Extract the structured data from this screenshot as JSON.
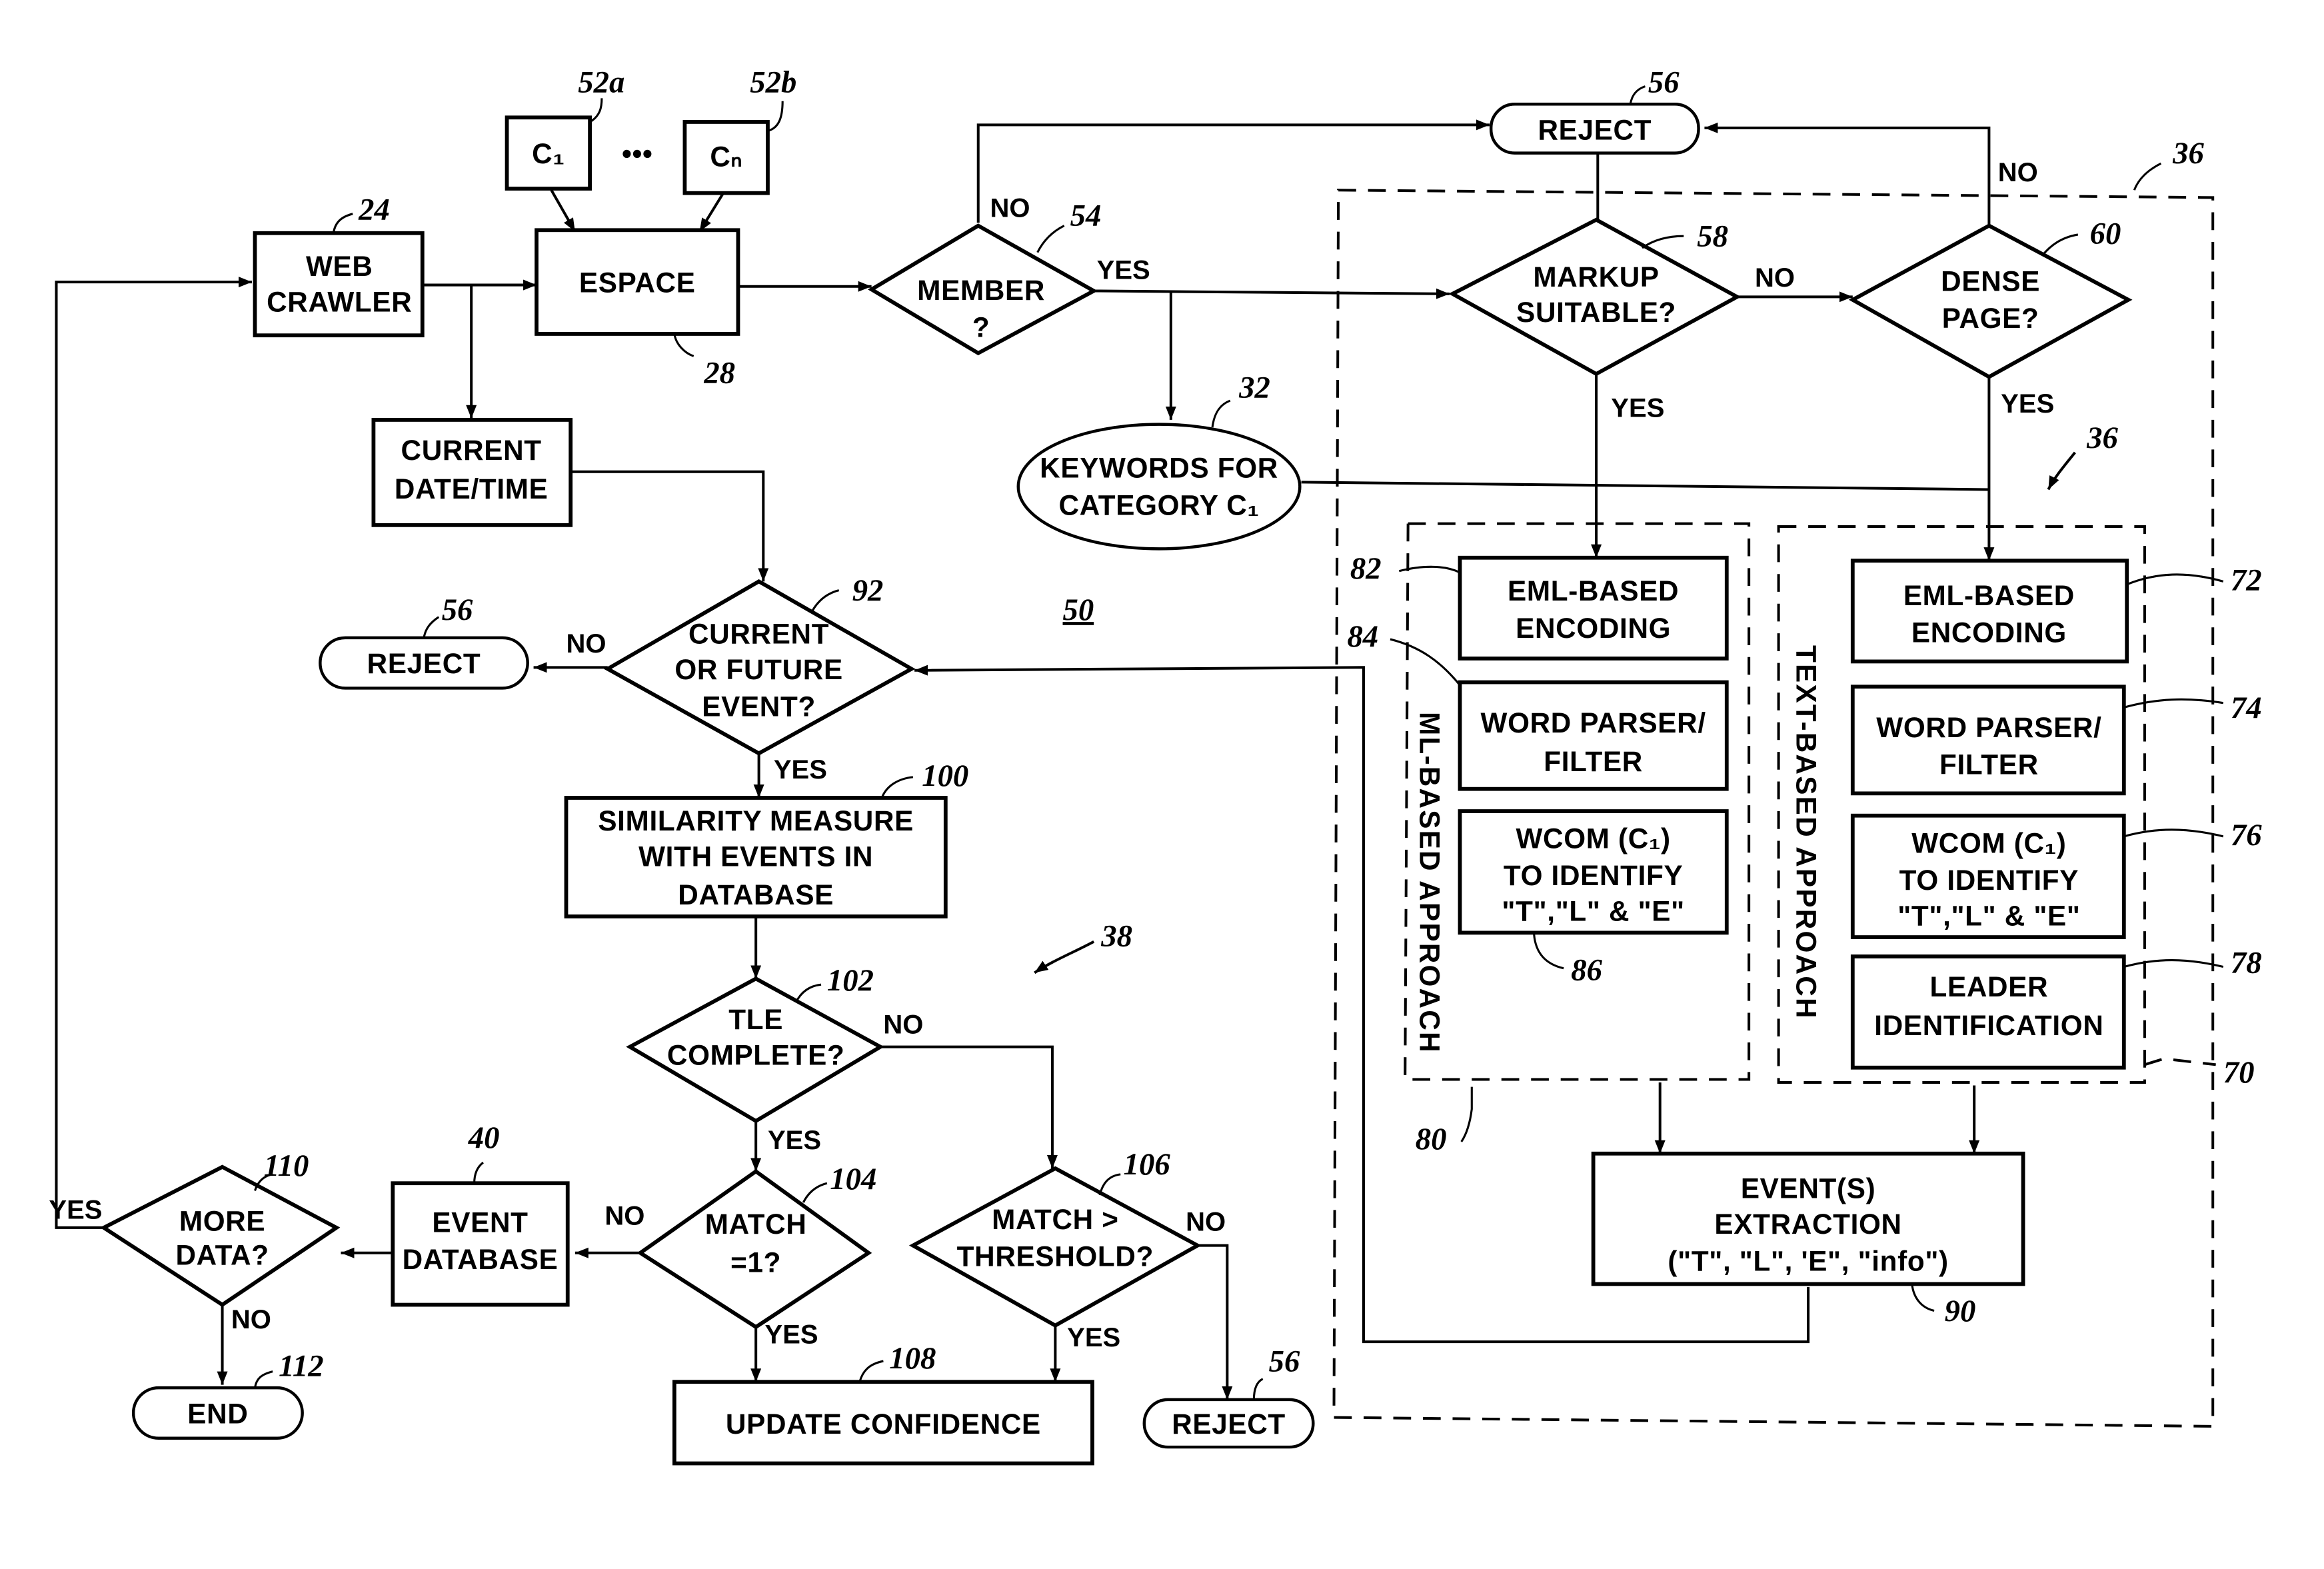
{
  "figure_number": "50",
  "nodes": {
    "web_crawler": {
      "lines": [
        "WEB",
        "CRAWLER"
      ],
      "ref": "24"
    },
    "espace": {
      "lines": [
        "ESPACE"
      ],
      "ref": "28"
    },
    "c1": {
      "lines": [
        "C₁"
      ],
      "ref": "52a"
    },
    "cn": {
      "lines": [
        "Cₙ"
      ],
      "ref": "52b"
    },
    "ellipsis": "•••",
    "member": {
      "lines": [
        "MEMBER",
        "?"
      ],
      "ref": "54"
    },
    "reject_top": {
      "label": "REJECT",
      "ref": "56"
    },
    "markup_suitable": {
      "lines": [
        "MARKUP",
        "SUITABLE?"
      ],
      "ref": "58"
    },
    "dense_page": {
      "lines": [
        "DENSE",
        "PAGE?"
      ],
      "ref": "60"
    },
    "keywords": {
      "lines": [
        "KEYWORDS FOR",
        "CATEGORY C₁"
      ],
      "ref": "32"
    },
    "current_datetime": {
      "lines": [
        "CURRENT",
        "DATE/TIME"
      ]
    },
    "current_future": {
      "lines": [
        "CURRENT",
        "OR FUTURE",
        "EVENT?"
      ],
      "ref": "92"
    },
    "reject_left": {
      "label": "REJECT",
      "ref": "56"
    },
    "similarity": {
      "lines": [
        "SIMILARITY MEASURE",
        "WITH EVENTS IN",
        "DATABASE"
      ],
      "ref": "100"
    },
    "tle_complete": {
      "lines": [
        "TLE",
        "COMPLETE?"
      ],
      "ref": "102"
    },
    "match_eq1": {
      "lines": [
        "MATCH",
        "=1?"
      ],
      "ref": "104"
    },
    "match_threshold": {
      "lines": [
        "MATCH >",
        "THRESHOLD?"
      ],
      "ref": "106"
    },
    "update_confidence": {
      "label": "UPDATE CONFIDENCE",
      "ref": "108"
    },
    "reject_bottom": {
      "label": "REJECT",
      "ref": "56"
    },
    "event_database": {
      "lines": [
        "EVENT",
        "DATABASE"
      ],
      "ref": "40"
    },
    "more_data": {
      "lines": [
        "MORE",
        "DATA?"
      ],
      "ref": "110"
    },
    "end": {
      "label": "END",
      "ref": "112"
    },
    "ml_eml": {
      "lines": [
        "EML-BASED",
        "ENCODING"
      ],
      "ref": "82"
    },
    "ml_parser": {
      "lines": [
        "WORD PARSER/",
        "FILTER"
      ],
      "ref": "84"
    },
    "ml_wcom": {
      "lines": [
        "WCOM (C₁)",
        "TO IDENTIFY",
        "\"T\",\"L\" & \"E\""
      ],
      "ref": "86"
    },
    "txt_eml": {
      "lines": [
        "EML-BASED",
        "ENCODING"
      ],
      "ref": "72"
    },
    "txt_parser": {
      "lines": [
        "WORD PARSER/",
        "FILTER"
      ],
      "ref": "74"
    },
    "txt_wcom": {
      "lines": [
        "WCOM (C₁)",
        "TO IDENTIFY",
        "\"T\",\"L\" & \"E\""
      ],
      "ref": "76"
    },
    "leader": {
      "lines": [
        "LEADER",
        "IDENTIFICATION"
      ],
      "ref": "78"
    },
    "extraction": {
      "lines": [
        "EVENT(S)",
        "EXTRACTION",
        "(\"T\", \"L\", 'E\", \"info\")"
      ],
      "ref": "90"
    }
  },
  "groups": {
    "outer": {
      "ref": "36"
    },
    "outer_arrow": {
      "ref": "36"
    },
    "ml_approach": {
      "label": "ML-BASED APPROACH",
      "ref": "80"
    },
    "text_approach": {
      "label": "TEXT-BASED APPROACH",
      "ref": "70"
    },
    "flow_38": {
      "ref": "38"
    }
  },
  "edge_labels": {
    "yes": "YES",
    "no": "NO"
  }
}
